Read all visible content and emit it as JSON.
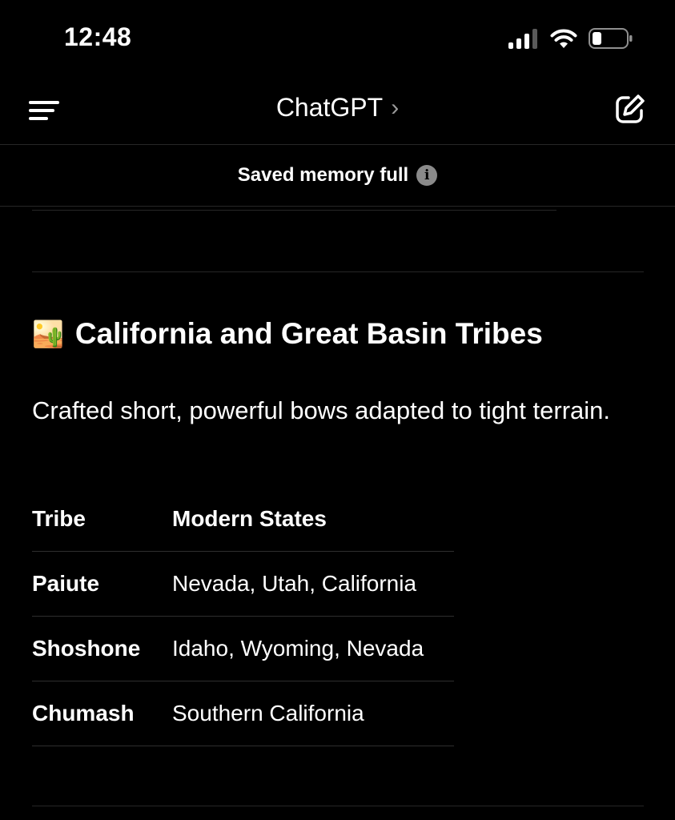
{
  "status_bar": {
    "time": "12:48",
    "icons": [
      "cellular-signal-icon",
      "wifi-icon",
      "battery-icon"
    ]
  },
  "navbar": {
    "title": "ChatGPT",
    "title_chevron": "›",
    "left_icon": "sidebar-menu-icon",
    "right_icon": "new-chat-icon"
  },
  "banner": {
    "text": "Saved memory full",
    "icon": "info-icon",
    "icon_glyph": "i"
  },
  "section": {
    "emoji": "🏜️",
    "title": "California and Great Basin Tribes",
    "description": "Crafted short, powerful bows adapted to tight terrain.",
    "table": {
      "headers": [
        "Tribe",
        "Modern States"
      ],
      "rows": [
        {
          "tribe": "Paiute",
          "states": "Nevada, Utah, California"
        },
        {
          "tribe": "Shoshone",
          "states": "Idaho, Wyoming, Nevada"
        },
        {
          "tribe": "Chumash",
          "states": "Southern California"
        }
      ]
    }
  },
  "colors": {
    "background": "#000000",
    "text": "#ffffff",
    "divider": "#262626",
    "info_icon": "#8a8a8a"
  }
}
